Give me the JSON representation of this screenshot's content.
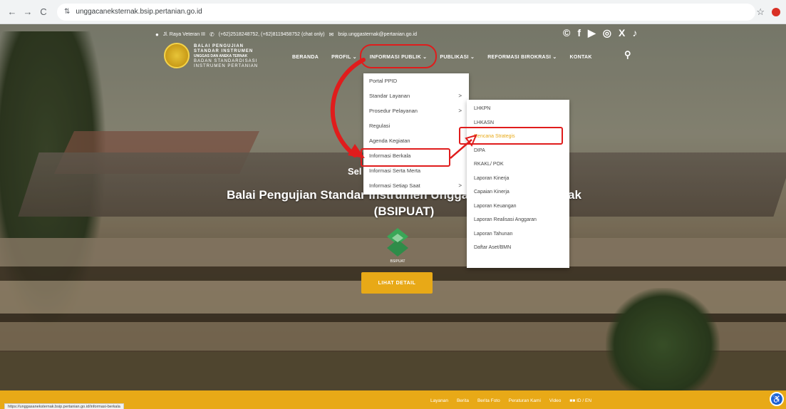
{
  "browser": {
    "url": "unggacaneksternak.bsip.pertanian.go.id",
    "back_icon": "←",
    "forward_icon": "→",
    "reload_icon": "C",
    "tune_icon": "⇅",
    "star_icon": "☆"
  },
  "topbar": {
    "address": "Jl. Raya Veteran III",
    "phone": "(+62)2518248752, (+62)8119458752 (chat only)",
    "email": "bsip.unggasternak@pertanian.go.id",
    "social": [
      "©",
      "f",
      "▶",
      "◎",
      "X",
      "♪"
    ]
  },
  "logo": {
    "line1": "BALAI PENGUJIAN",
    "line2": "STANDAR INSTRUMEN",
    "line3": "UNGGAS DAN ANEKA TERNAK",
    "line4": "BADAN STANDARDISASI",
    "line5": "INSTRUMEN PERTANIAN"
  },
  "nav": {
    "beranda": "BERANDA",
    "profil": "PROFIL ⌄",
    "informasi_publik": "INFORMASI PUBLIK ⌄",
    "publikasi": "PUBLIKASI ⌄",
    "reformasi": "REFORMASI BIROKRASI ⌄",
    "kontak": "KONTAK",
    "search_icon": "⚲"
  },
  "dropdown1": {
    "items": [
      {
        "label": "Portal PPID",
        "arrow": ""
      },
      {
        "label": "Standar Layanan",
        "arrow": ">"
      },
      {
        "label": "Prosedur Pelayanan",
        "arrow": ">"
      },
      {
        "label": "Regulasi",
        "arrow": ""
      },
      {
        "label": "Agenda Kegiatan",
        "arrow": ""
      },
      {
        "label": "Informasi Berkala",
        "arrow": ""
      },
      {
        "label": "Informasi Serta Merta",
        "arrow": ""
      },
      {
        "label": "Informasi Setiap Saat",
        "arrow": ">"
      }
    ]
  },
  "dropdown2": {
    "items": [
      "LHKPN",
      "LHKASN",
      "Rencana Strategis",
      "DIPA",
      "RKAKL/ POK",
      "Laporan Kinerja",
      "Capaian Kinerja",
      "Laporan Keuangan",
      "Laporan Realisasi Anggaran",
      "Laporan Tahunan",
      "Daftar Aset/BMN"
    ]
  },
  "hero": {
    "small": "Sel",
    "title": "Balai Pengujian Standar Instrumen Unggas dan Aneka Ternak (BSIPUAT)",
    "logo_caption": "BSIPUAT",
    "button": "LIHAT DETAIL"
  },
  "footer": {
    "links": [
      "Layanan",
      "Berita",
      "Berita Foto",
      "Peraturan Kami",
      "Video",
      "■■ ID / EN"
    ],
    "status_url": "https://unggasaneksternak.bsip.pertanian.go.id/informasi-berkala"
  },
  "colors": {
    "accent": "#e8a917",
    "annotation": "#e01c1c"
  }
}
